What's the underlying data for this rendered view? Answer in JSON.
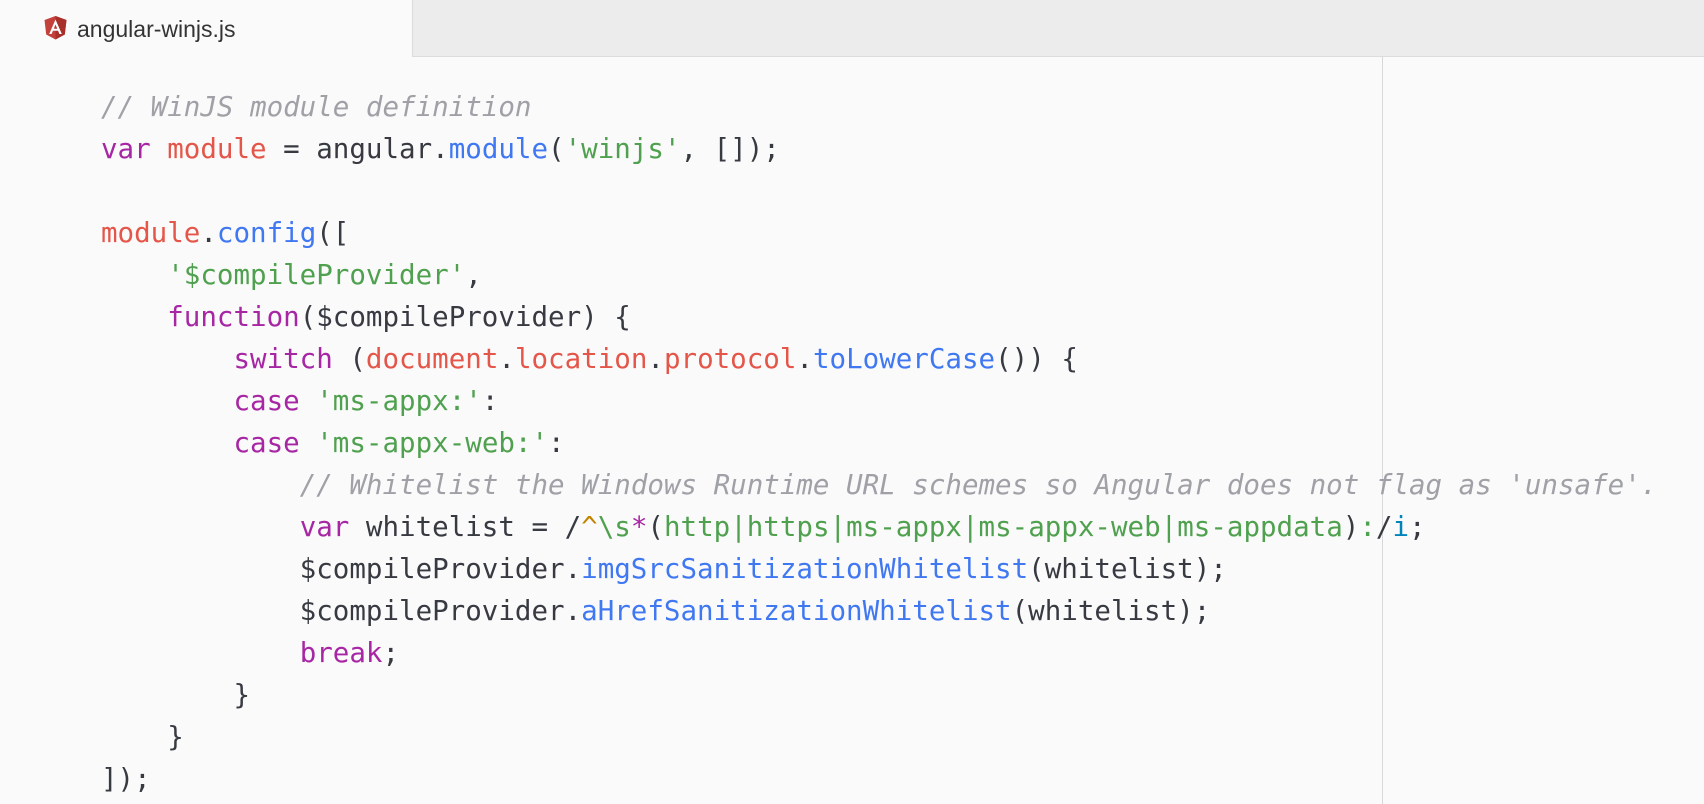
{
  "tab": {
    "filename": "angular-winjs.js",
    "icon": "angular-icon"
  },
  "colors": {
    "comment": "#a0a1a7",
    "keyword": "#a626a4",
    "variable": "#e45649",
    "function": "#4078f2",
    "string": "#50a14f",
    "plain": "#383a42"
  },
  "code_lines": [
    [
      {
        "t": "// WinJS module definition",
        "c": "c"
      }
    ],
    [
      {
        "t": "var",
        "c": "k"
      },
      {
        "t": " ",
        "c": "n"
      },
      {
        "t": "module",
        "c": "v"
      },
      {
        "t": " = angular.",
        "c": "n"
      },
      {
        "t": "module",
        "c": "f"
      },
      {
        "t": "(",
        "c": "p"
      },
      {
        "t": "'winjs'",
        "c": "s"
      },
      {
        "t": ", []);",
        "c": "p"
      }
    ],
    [],
    [
      {
        "t": "module",
        "c": "v"
      },
      {
        "t": ".",
        "c": "p"
      },
      {
        "t": "config",
        "c": "f"
      },
      {
        "t": "([",
        "c": "p"
      }
    ],
    [
      {
        "t": "    ",
        "c": "n"
      },
      {
        "t": "'$compileProvider'",
        "c": "s"
      },
      {
        "t": ",",
        "c": "p"
      }
    ],
    [
      {
        "t": "    ",
        "c": "n"
      },
      {
        "t": "function",
        "c": "k"
      },
      {
        "t": "($compileProvider) {",
        "c": "n"
      }
    ],
    [
      {
        "t": "        ",
        "c": "n"
      },
      {
        "t": "switch",
        "c": "k"
      },
      {
        "t": " (",
        "c": "p"
      },
      {
        "t": "document",
        "c": "v"
      },
      {
        "t": ".",
        "c": "p"
      },
      {
        "t": "location",
        "c": "v"
      },
      {
        "t": ".",
        "c": "p"
      },
      {
        "t": "protocol",
        "c": "v"
      },
      {
        "t": ".",
        "c": "p"
      },
      {
        "t": "toLowerCase",
        "c": "f"
      },
      {
        "t": "()) {",
        "c": "p"
      }
    ],
    [
      {
        "t": "        ",
        "c": "n"
      },
      {
        "t": "case",
        "c": "k"
      },
      {
        "t": " ",
        "c": "n"
      },
      {
        "t": "'ms-appx:'",
        "c": "s"
      },
      {
        "t": ":",
        "c": "p"
      }
    ],
    [
      {
        "t": "        ",
        "c": "n"
      },
      {
        "t": "case",
        "c": "k"
      },
      {
        "t": " ",
        "c": "n"
      },
      {
        "t": "'ms-appx-web:'",
        "c": "s"
      },
      {
        "t": ":",
        "c": "p"
      }
    ],
    [
      {
        "t": "            ",
        "c": "n"
      },
      {
        "t": "// Whitelist the Windows Runtime URL schemes so Angular does not flag as 'unsafe'.",
        "c": "c"
      }
    ],
    [
      {
        "t": "            ",
        "c": "n"
      },
      {
        "t": "var",
        "c": "k"
      },
      {
        "t": " whitelist = /",
        "c": "n"
      },
      {
        "t": "^",
        "c": "ra"
      },
      {
        "t": "\\s",
        "c": "re"
      },
      {
        "t": "*",
        "c": "rk"
      },
      {
        "t": "(",
        "c": "n"
      },
      {
        "t": "http|https|ms-appx|ms-appx-web|ms-appdata",
        "c": "re"
      },
      {
        "t": ")",
        "c": "n"
      },
      {
        "t": ":",
        "c": "re"
      },
      {
        "t": "/",
        "c": "n"
      },
      {
        "t": "i",
        "c": "rf"
      },
      {
        "t": ";",
        "c": "p"
      }
    ],
    [
      {
        "t": "            $compileProvider.",
        "c": "n"
      },
      {
        "t": "imgSrcSanitizationWhitelist",
        "c": "f"
      },
      {
        "t": "(whitelist);",
        "c": "n"
      }
    ],
    [
      {
        "t": "            $compileProvider.",
        "c": "n"
      },
      {
        "t": "aHrefSanitizationWhitelist",
        "c": "f"
      },
      {
        "t": "(whitelist);",
        "c": "n"
      }
    ],
    [
      {
        "t": "            ",
        "c": "n"
      },
      {
        "t": "break",
        "c": "k"
      },
      {
        "t": ";",
        "c": "p"
      }
    ],
    [
      {
        "t": "        }",
        "c": "p"
      }
    ],
    [
      {
        "t": "    }",
        "c": "p"
      }
    ],
    [
      {
        "t": "]);",
        "c": "p"
      }
    ]
  ]
}
